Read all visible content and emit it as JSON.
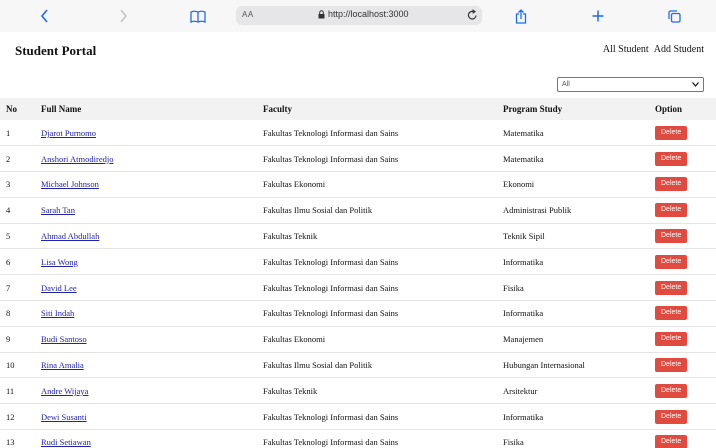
{
  "browser": {
    "reader_label": "AA",
    "url": "http://localhost:3000"
  },
  "header": {
    "brand": "Student Portal",
    "nav": {
      "all_student": "All Student",
      "add_student": "Add Student"
    }
  },
  "filter": {
    "selected": "All"
  },
  "table": {
    "columns": [
      "No",
      "Full Name",
      "Faculty",
      "Program Study",
      "Option"
    ],
    "delete_label": "Delete",
    "rows": [
      {
        "no": "1",
        "name": "Djarot Purnomo",
        "faculty": "Fakultas Teknologi Informasi dan Sains",
        "program": "Matematika"
      },
      {
        "no": "2",
        "name": "Anshori Atmodiredjo",
        "faculty": "Fakultas Teknologi Informasi dan Sains",
        "program": "Matematika"
      },
      {
        "no": "3",
        "name": "Michael Johnson",
        "faculty": "Fakultas Ekonomi",
        "program": "Ekonomi"
      },
      {
        "no": "4",
        "name": "Sarah Tan",
        "faculty": "Fakultas Ilmu Sosial dan Politik",
        "program": "Administrasi Publik"
      },
      {
        "no": "5",
        "name": "Ahmad Abdullah",
        "faculty": "Fakultas Teknik",
        "program": "Teknik Sipil"
      },
      {
        "no": "6",
        "name": "Lisa Wong",
        "faculty": "Fakultas Teknologi Informasi dan Sains",
        "program": "Informatika"
      },
      {
        "no": "7",
        "name": "David Lee",
        "faculty": "Fakultas Teknologi Informasi dan Sains",
        "program": "Fisika"
      },
      {
        "no": "8",
        "name": "Siti Indah",
        "faculty": "Fakultas Teknologi Informasi dan Sains",
        "program": "Informatika"
      },
      {
        "no": "9",
        "name": "Budi Santoso",
        "faculty": "Fakultas Ekonomi",
        "program": "Manajemen"
      },
      {
        "no": "10",
        "name": "Rina Amalia",
        "faculty": "Fakultas Ilmu Sosial dan Politik",
        "program": "Hubungan Internasional"
      },
      {
        "no": "11",
        "name": "Andre Wijaya",
        "faculty": "Fakultas Teknik",
        "program": "Arsitektur"
      },
      {
        "no": "12",
        "name": "Dewi Susanti",
        "faculty": "Fakultas Teknologi Informasi dan Sains",
        "program": "Informatika"
      },
      {
        "no": "13",
        "name": "Rudi Setiawan",
        "faculty": "Fakultas Teknologi Informasi dan Sains",
        "program": "Fisika"
      }
    ]
  },
  "colors": {
    "accent_blue": "#1e6cf0",
    "delete_red": "#e04a3f",
    "link": "#2222aa"
  }
}
